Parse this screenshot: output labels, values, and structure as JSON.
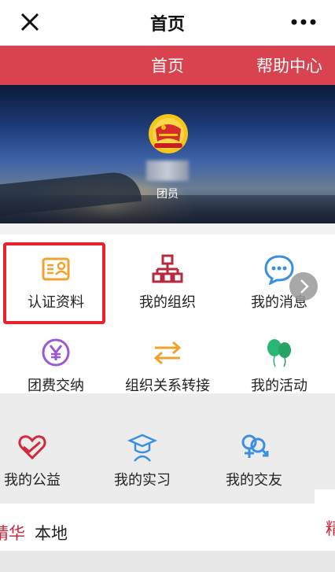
{
  "app": {
    "title": "首页"
  },
  "nav": {
    "tabs": [
      {
        "label": "首页"
      },
      {
        "label": "帮助中心"
      }
    ]
  },
  "profile": {
    "role": "团员"
  },
  "grid": [
    {
      "label": "认证资料",
      "icon": "id-card-icon"
    },
    {
      "label": "我的组织",
      "icon": "org-tree-icon"
    },
    {
      "label": "我的消息",
      "icon": "chat-bubble-icon"
    },
    {
      "label": "团费交纳",
      "icon": "yen-icon"
    },
    {
      "label": "组织关系转接",
      "icon": "transfer-arrows-icon"
    },
    {
      "label": "我的活动",
      "icon": "balloons-icon"
    }
  ],
  "services": [
    {
      "label": "我的公益",
      "icon": "heart-hand-icon"
    },
    {
      "label": "我的实习",
      "icon": "graduate-icon"
    },
    {
      "label": "我的交友",
      "icon": "gender-icon"
    }
  ],
  "feed_tabs": [
    {
      "label": "精华"
    },
    {
      "label": "本地"
    }
  ],
  "side_text": "精",
  "colors": {
    "brand_red": "#d8434f",
    "highlight_red": "#e8212b"
  }
}
